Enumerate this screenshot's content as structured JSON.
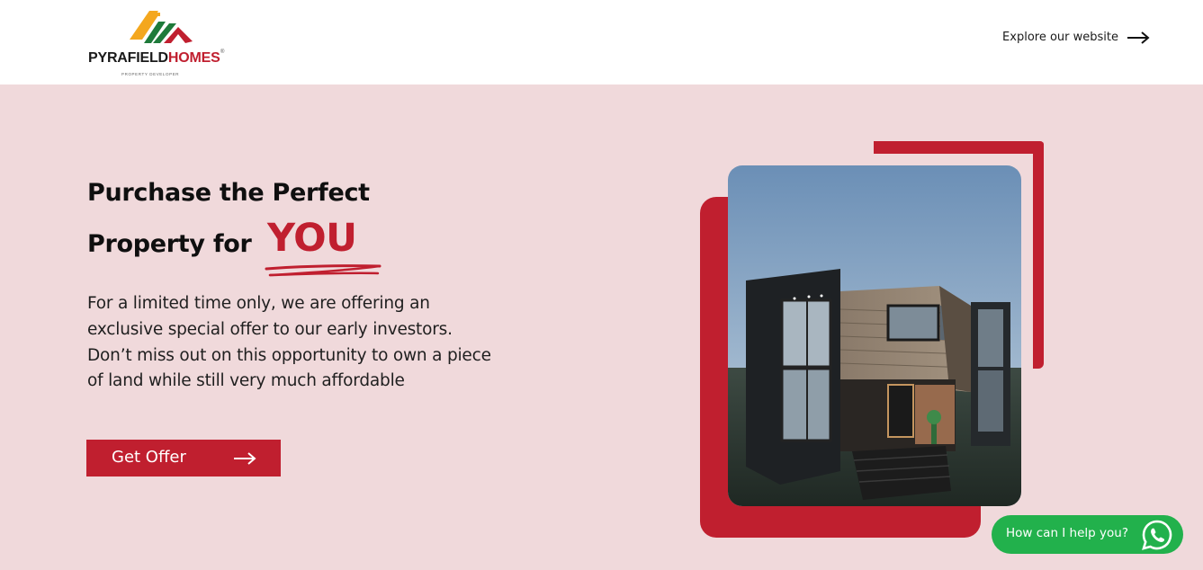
{
  "header": {
    "logo": {
      "brand_part1": "PYRAFIELD",
      "brand_part2": "HOMES",
      "tm": "®",
      "tagline": "PROPERTY DEVELOPER"
    },
    "explore_link": "Explore our website"
  },
  "hero": {
    "title_line1": "Purchase the Perfect",
    "title_line2": "Property for",
    "title_highlight": "YOU",
    "description": "For a limited time only, we are offering an exclusive special offer to our early investors. Don’t miss out on this opportunity to own a piece of land while still very much affordable",
    "cta_label": "Get Offer",
    "image_alt": "Modern two-storey house rendering"
  },
  "chat_widget": {
    "label": "How can I help you?"
  },
  "colors": {
    "accent": "#c01f2f",
    "background": "#f0d9db",
    "whatsapp": "#22b14c"
  },
  "icons": {
    "explore": "arrow-right-icon",
    "cta": "arrow-right-icon",
    "chat": "whatsapp-icon"
  }
}
